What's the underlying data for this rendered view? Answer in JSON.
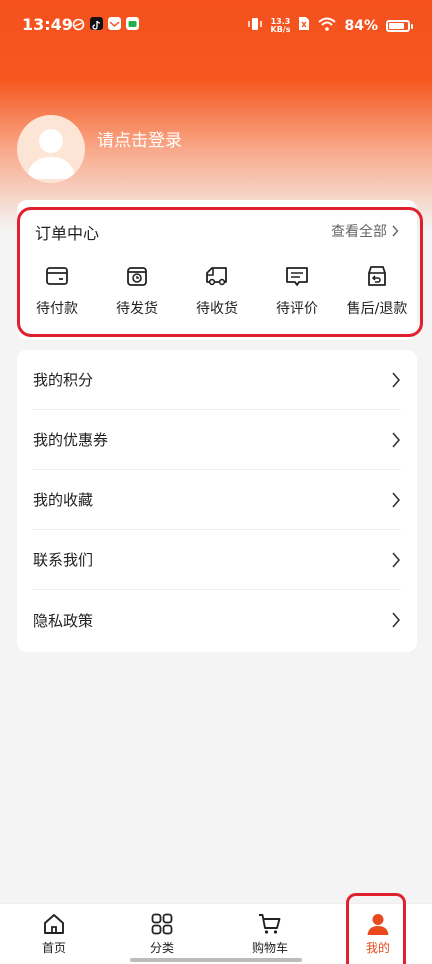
{
  "status_bar": {
    "time": "13:49",
    "net_speed_value": "13.3",
    "net_speed_unit": "KB/s",
    "battery": "84%",
    "battery_level": 0.84,
    "app_icons": [
      "weibo-icon",
      "tiktok-icon",
      "mail-icon",
      "wechat-icon"
    ],
    "system_icons": [
      "vibrate-icon",
      "no-sim-icon",
      "wifi-icon",
      "battery-icon"
    ]
  },
  "profile": {
    "login_prompt": "请点击登录",
    "avatar_icon": "default-avatar-icon"
  },
  "orders": {
    "title": "订单中心",
    "view_all": "查看全部",
    "items": [
      {
        "label": "待付款",
        "icon": "wallet-icon"
      },
      {
        "label": "待发货",
        "icon": "package-clock-icon"
      },
      {
        "label": "待收货",
        "icon": "truck-icon"
      },
      {
        "label": "待评价",
        "icon": "comment-icon"
      },
      {
        "label": "售后/退款",
        "icon": "refund-box-icon"
      }
    ]
  },
  "menu": {
    "items": [
      {
        "label": "我的积分"
      },
      {
        "label": "我的优惠券"
      },
      {
        "label": "我的收藏"
      },
      {
        "label": "联系我们"
      },
      {
        "label": "隐私政策"
      }
    ]
  },
  "tabbar": {
    "items": [
      {
        "label": "首页",
        "icon": "home-icon"
      },
      {
        "label": "分类",
        "icon": "category-grid-icon"
      },
      {
        "label": "购物车",
        "icon": "cart-icon"
      },
      {
        "label": "我的",
        "icon": "user-icon"
      }
    ],
    "active_index": 3
  },
  "colors": {
    "brand": "#f4511e",
    "active_tab": "#e8491d",
    "highlight_box": "#e0202e"
  }
}
